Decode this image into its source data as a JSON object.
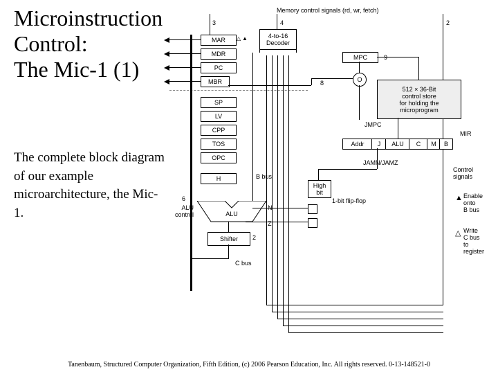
{
  "title_line1": "Microinstruction",
  "title_line2": "Control:",
  "title_line3": "The Mic-1 (1)",
  "caption": "The complete block diagram of our example microarchitecture, the Mic-1.",
  "footer": "Tanenbaum, Structured Computer Organization, Fifth Edition, (c) 2006 Pearson Education, Inc. All rights reserved. 0-13-148521-0",
  "diagram": {
    "top_label": "Memory control signals (rd, wr, fetch)",
    "top_nums": {
      "a": "3",
      "b": "4",
      "c": "2"
    },
    "decoder": "4-to-16\nDecoder",
    "registers": [
      "MAR",
      "MDR",
      "PC",
      "MBR",
      "SP",
      "LV",
      "CPP",
      "TOS",
      "OPC",
      "H"
    ],
    "alu": "ALU",
    "alu_control": "ALU\ncontrol",
    "shifter": "Shifter",
    "cbus": "C bus",
    "bbus": "B bus",
    "n": "N",
    "z": "Z",
    "six": "6",
    "two": "2",
    "nine": "9",
    "eight": "8",
    "mpc": "MPC",
    "o": "O",
    "store": "512 × 36-Bit\ncontrol store\nfor holding the\nmicroprogram",
    "jmpc": "JMPC",
    "mir": "MIR",
    "mir_fields": [
      "Addr",
      "J",
      "ALU",
      "C",
      "M",
      "B"
    ],
    "jamnz": "JAMN/JAMZ",
    "highbit": "High\nbit",
    "flipflop": "1-bit flip-flop",
    "control_signals": "Control\nsignals",
    "legend_enable": "Enable\nonto\nB bus",
    "legend_write": "Write\nC bus\nto\nregister",
    "arrow_filled": "▲",
    "arrow_open": "△"
  }
}
